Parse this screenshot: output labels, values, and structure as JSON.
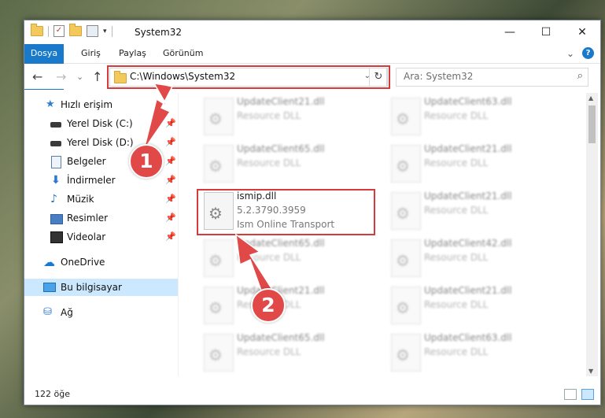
{
  "window": {
    "title": "System32",
    "qat_dropdown": "▾",
    "minimize": "—",
    "maximize": "☐",
    "close": "✕"
  },
  "ribbon": {
    "tabs": [
      "Dosya",
      "Giriş",
      "Paylaş",
      "Görünüm"
    ],
    "expand_glyph": "⌄",
    "help_glyph": "?"
  },
  "nav": {
    "back": "←",
    "forward": "→",
    "recent": "⌄",
    "up": "↑",
    "address": "C:\\Windows\\System32",
    "address_drop": "⌄",
    "refresh": "↻",
    "search_placeholder": "Ara: System32",
    "search_icon": "⌕"
  },
  "sidebar": {
    "pin_glyph": "📌",
    "items": [
      {
        "label": "Hızlı erişim",
        "icon": "star-icon"
      },
      {
        "label": "Yerel Disk (C:)",
        "icon": "drive-icon",
        "pinned": true
      },
      {
        "label": "Yerel Disk (D:)",
        "icon": "drive-icon",
        "pinned": true
      },
      {
        "label": "Belgeler",
        "icon": "document-icon",
        "pinned": true
      },
      {
        "label": "İndirmeler",
        "icon": "download-icon",
        "pinned": true
      },
      {
        "label": "Müzik",
        "icon": "music-icon",
        "pinned": true
      },
      {
        "label": "Resimler",
        "icon": "pictures-icon",
        "pinned": true
      },
      {
        "label": "Videolar",
        "icon": "video-icon",
        "pinned": true
      },
      {
        "label": "OneDrive",
        "icon": "cloud-icon"
      },
      {
        "label": "Bu bilgisayar",
        "icon": "computer-icon",
        "selected": true
      },
      {
        "label": "Ağ",
        "icon": "network-icon"
      }
    ]
  },
  "files": {
    "col1": [
      {
        "name": "UpdateClient21.dll",
        "desc": "Resource DLL"
      },
      {
        "name": "UpdateClient65.dll",
        "desc": "Resource DLL"
      },
      {
        "name": "ismip.dll",
        "version": "5.2.3790.3959",
        "desc": "Ism Online Transport",
        "highlight": true
      },
      {
        "name": "UpdateClient65.dll",
        "desc": "Resource DLL"
      },
      {
        "name": "UpdateClient21.dll",
        "desc": "Resource DLL"
      },
      {
        "name": "UpdateClient65.dll",
        "desc": "Resource DLL"
      }
    ],
    "col2": [
      {
        "name": "UpdateClient63.dll",
        "desc": "Resource DLL"
      },
      {
        "name": "UpdateClient21.dll",
        "desc": "Resource DLL"
      },
      {
        "name": "UpdateClient21.dll",
        "desc": "Resource DLL"
      },
      {
        "name": "UpdateClient42.dll",
        "desc": "Resource DLL"
      },
      {
        "name": "UpdateClient21.dll",
        "desc": "Resource DLL"
      },
      {
        "name": "UpdateClient63.dll",
        "desc": "Resource DLL"
      }
    ]
  },
  "status": {
    "count": "122 öğe"
  },
  "annotations": {
    "step1": "1",
    "step2": "2",
    "color": "#e14848"
  }
}
